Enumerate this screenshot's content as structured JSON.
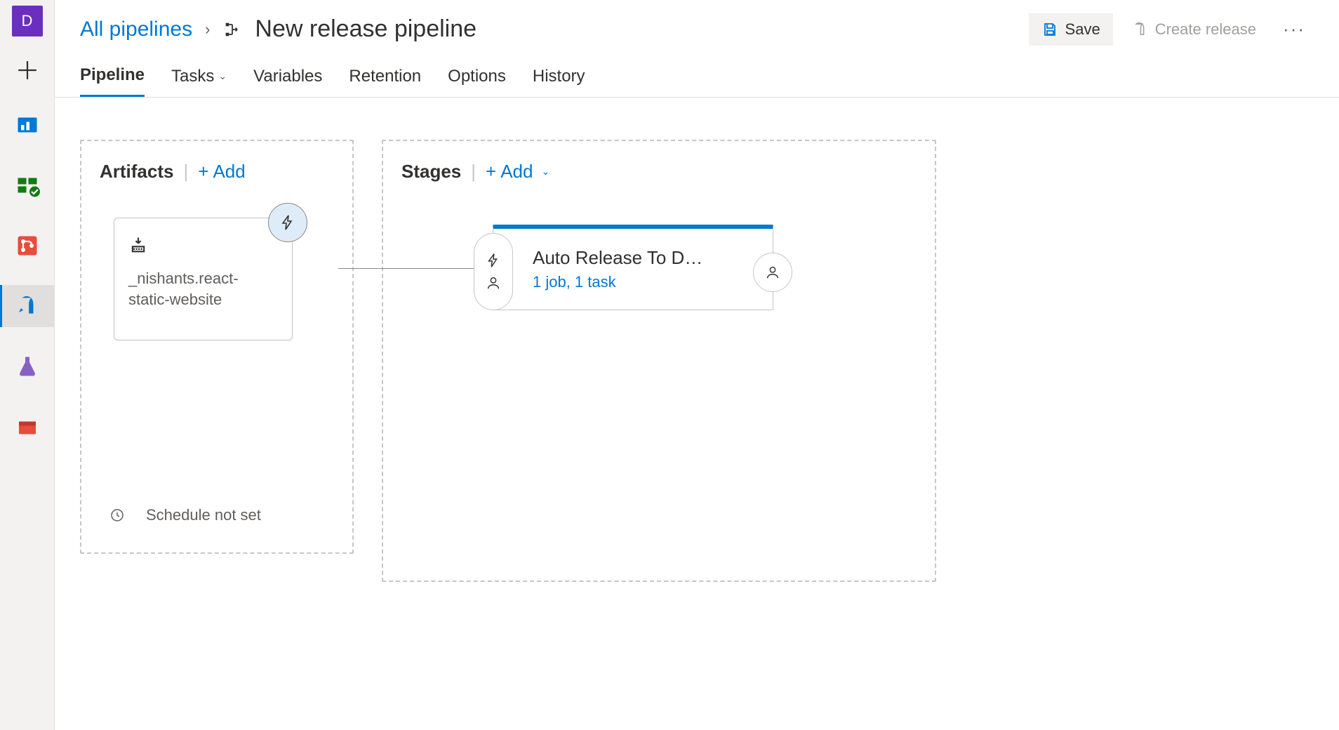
{
  "sidebar": {
    "avatar_letter": "D"
  },
  "breadcrumb": {
    "root": "All pipelines",
    "title": "New release pipeline"
  },
  "actions": {
    "save": "Save",
    "create_release": "Create release"
  },
  "tabs": [
    {
      "label": "Pipeline",
      "active": true,
      "dropdown": false
    },
    {
      "label": "Tasks",
      "active": false,
      "dropdown": true
    },
    {
      "label": "Variables",
      "active": false,
      "dropdown": false
    },
    {
      "label": "Retention",
      "active": false,
      "dropdown": false
    },
    {
      "label": "Options",
      "active": false,
      "dropdown": false
    },
    {
      "label": "History",
      "active": false,
      "dropdown": false
    }
  ],
  "artifacts": {
    "header": "Artifacts",
    "add_label": "Add",
    "source_name": "_nishants.react-static-website",
    "schedule_label": "Schedule not set"
  },
  "stages": {
    "header": "Stages",
    "add_label": "Add",
    "stage_title": "Auto Release To D…",
    "stage_sub": "1 job, 1 task"
  }
}
